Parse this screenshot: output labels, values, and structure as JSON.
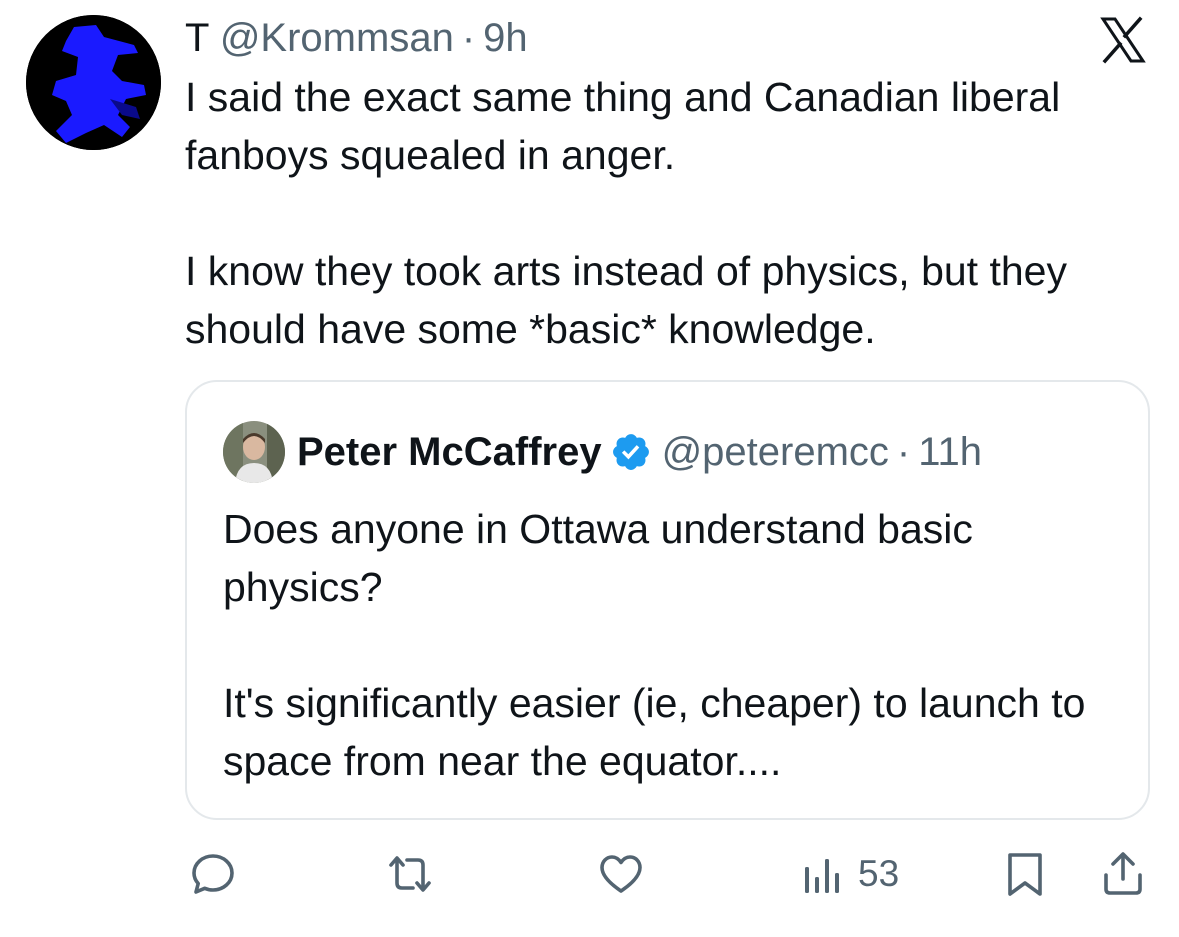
{
  "tweet": {
    "author_name": "T",
    "author_handle": "@Krommsan",
    "separator": "·",
    "time": "9h",
    "paragraphs": [
      "I said the exact same thing and Canadian liberal fanboys squealed in anger.",
      "I know they took arts instead of physics, but they should have some *basic* knowledge."
    ]
  },
  "quoted_tweet": {
    "author_name": "Peter McCaffrey",
    "author_handle": "@peteremcc",
    "separator": "·",
    "time": "11h",
    "verified": true,
    "paragraphs": [
      "Does anyone in Ottawa understand basic physics?",
      "It's significantly easier (ie, cheaper) to launch to space from near the equator...."
    ]
  },
  "actions": {
    "reply_icon": "reply-icon",
    "retweet_icon": "retweet-icon",
    "like_icon": "heart-icon",
    "views_icon": "views-icon",
    "views_count": "53",
    "bookmark_icon": "bookmark-icon",
    "share_icon": "share-icon"
  },
  "colors": {
    "text": "#0f1419",
    "secondary_text": "#536471",
    "verified_blue": "#1d9bf0",
    "border": "#e4e8eb",
    "avatar_blue": "#1a1aff"
  }
}
